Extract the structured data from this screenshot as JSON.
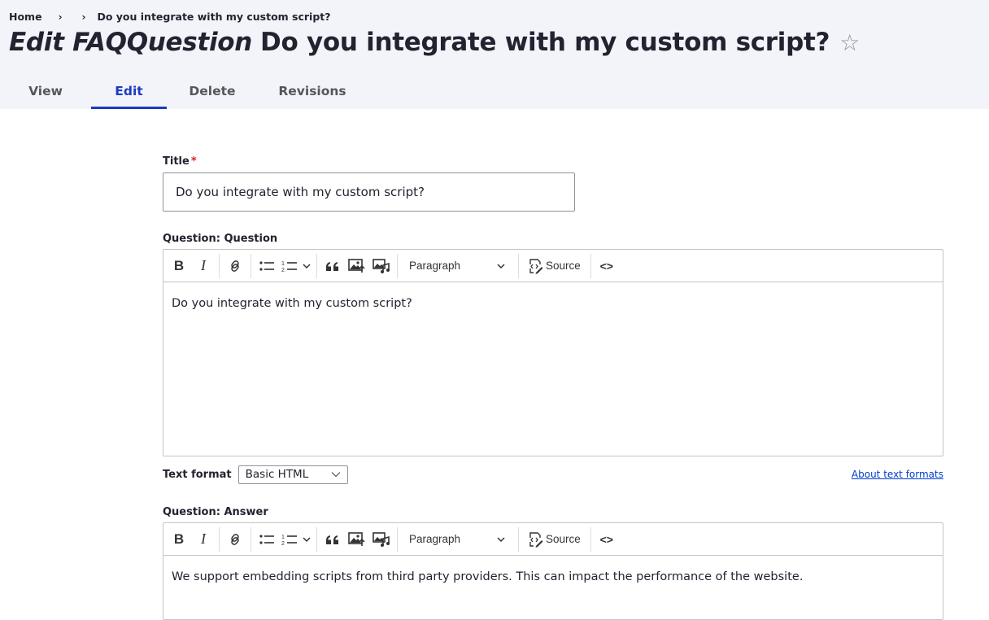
{
  "breadcrumb": {
    "home": "Home",
    "separator": "›",
    "current": "Do you integrate with my custom script?"
  },
  "page": {
    "title_prefix": "Edit FAQQuestion",
    "title_name": "Do you integrate with my custom script?",
    "star_icon": "☆"
  },
  "tabs": [
    {
      "label": "View",
      "active": false
    },
    {
      "label": "Edit",
      "active": true
    },
    {
      "label": "Delete",
      "active": false
    },
    {
      "label": "Revisions",
      "active": false
    }
  ],
  "form": {
    "title": {
      "label": "Title",
      "required_marker": "*",
      "value": "Do you integrate with my custom script?"
    },
    "question": {
      "label": "Question: Question",
      "body": "Do you integrate with my custom script?"
    },
    "text_format": {
      "label": "Text format",
      "selected": "Basic HTML",
      "help_link": "About text formats"
    },
    "answer": {
      "label": "Question: Answer",
      "body": "We support embedding scripts from third party providers. This can impact the performance of the website."
    }
  },
  "toolbar": {
    "bold": "B",
    "italic": "I",
    "heading_dropdown": "Paragraph",
    "source_label": "Source",
    "code_label": "<>"
  },
  "colors": {
    "accent": "#1c3bbf",
    "header_bg": "#f3f4f9",
    "required": "#d72222",
    "link": "#003ecc"
  }
}
